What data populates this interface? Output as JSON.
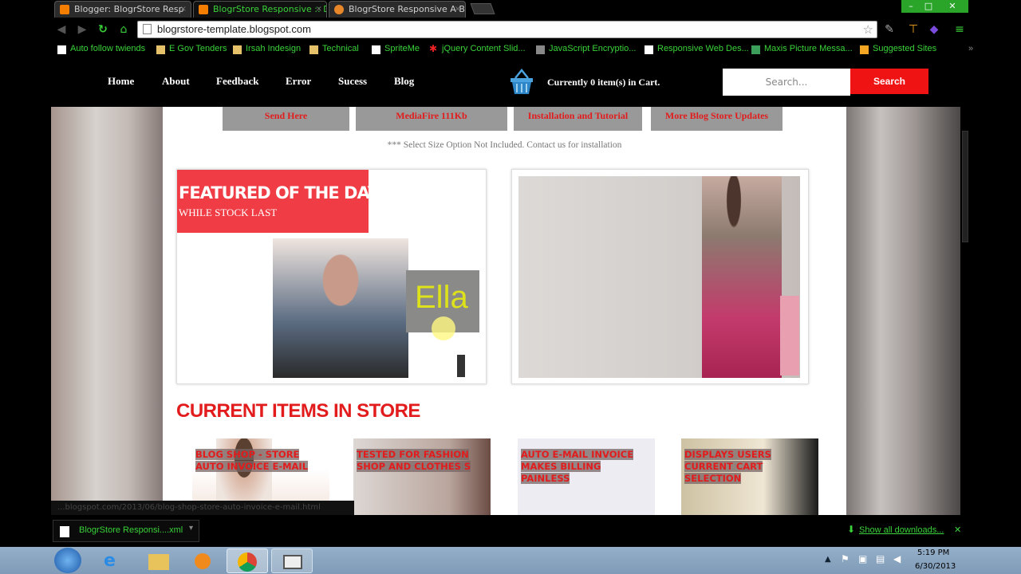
{
  "browser": {
    "tabs": [
      {
        "title": "Blogger: BlogrStore Resp"
      },
      {
        "title": "BlogrStore Responsive :: D"
      },
      {
        "title": "BlogrStore Responsive A B"
      }
    ],
    "close_glyph": "×",
    "window_controls": {
      "minimize": "–",
      "maximize": "□",
      "close": "✕"
    },
    "url": "blogrstore-template.blogspot.com",
    "bookmarks": [
      {
        "label": "Auto follow twiends",
        "icon": "page-icon"
      },
      {
        "label": "E Gov Tenders",
        "icon": "folder-icon"
      },
      {
        "label": "Irsah Indesign",
        "icon": "folder-icon"
      },
      {
        "label": "Technical",
        "icon": "folder-icon"
      },
      {
        "label": "SpriteMe",
        "icon": "page-icon"
      },
      {
        "label": "jQuery Content Slid...",
        "icon": "star-icon"
      },
      {
        "label": "JavaScript Encryptio...",
        "icon": "page-icon"
      },
      {
        "label": "Responsive Web Des...",
        "icon": "page-icon"
      },
      {
        "label": "Maxis Picture Messa...",
        "icon": "page-icon"
      },
      {
        "label": "Suggested Sites",
        "icon": "page-icon"
      }
    ],
    "status_url": "...blogspot.com/2013/06/blog-shop-store-auto-invoice-e-mail.html"
  },
  "site": {
    "nav": [
      "Home",
      "About",
      "Feedback",
      "Error",
      "Sucess",
      "Blog"
    ],
    "cart_prefix": "Currently ",
    "cart_count": "0",
    "cart_suffix": " item(s) in Cart.",
    "search_placeholder": "Search...",
    "search_button": "Search",
    "download_buttons": [
      "Send Here",
      "MediaFire 111Kb",
      "Installation and Tutorial",
      "More Blog Store Updates"
    ],
    "note": "*** Select Size Option Not Included. Contact us for installation",
    "featured_title": "FEATURED OF THE DAY →",
    "featured_subtitle": "WHILE STOCK LAST",
    "ella_text": "Ella",
    "current_heading": "CURRENT ITEMS IN STORE",
    "items": [
      {
        "label": "BLOG SHOP - STORE AUTO INVOICE E-MAIL"
      },
      {
        "label": "TESTED FOR FASHION SHOP AND CLOTHES S"
      },
      {
        "label": "AUTO E-MAIL INVOICE MAKES BILLING PAINLESS"
      },
      {
        "label": "DISPLAYS USERS CURRENT CART SELECTION"
      }
    ]
  },
  "downloads": {
    "file": "BlogrStore Responsi....xml",
    "show_all": "Show all downloads...",
    "close_glyph": "✕"
  },
  "taskbar": {
    "time": "5:19 PM",
    "date": "6/30/2013"
  },
  "colors": {
    "accent_red": "#ef2c35",
    "chrome_green": "#39d339"
  }
}
